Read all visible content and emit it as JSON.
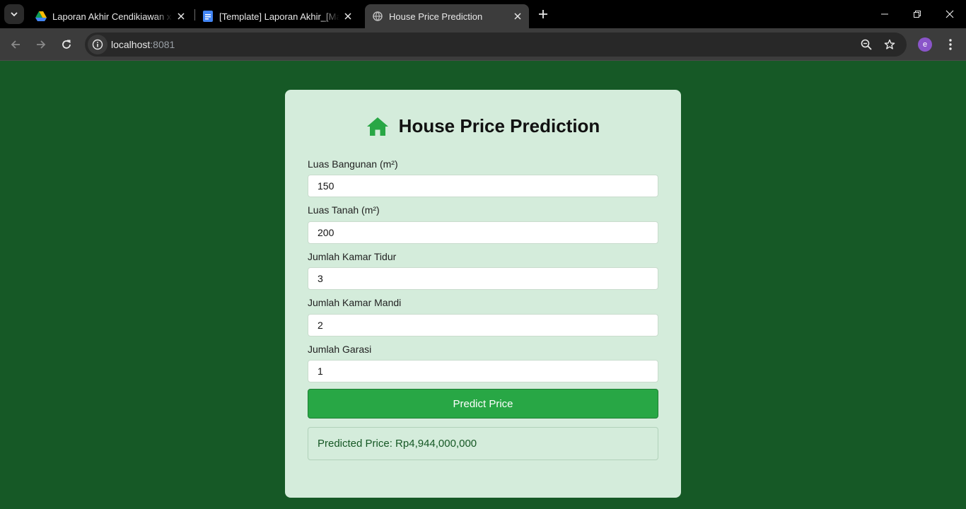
{
  "browser": {
    "tabs": [
      {
        "title": "Laporan Akhir Cendikiawan x Ka",
        "icon": "google-drive-icon",
        "active": false
      },
      {
        "title": "[Template] Laporan Akhir_[Mag",
        "icon": "google-docs-icon",
        "active": false
      },
      {
        "title": "House Price Prediction",
        "icon": "globe-icon",
        "active": true
      }
    ],
    "url_host": "localhost",
    "url_port": ":8081",
    "profile_initial": "e"
  },
  "page": {
    "title": "House Price Prediction",
    "fields": [
      {
        "label": "Luas Bangunan (m²)",
        "value": "150"
      },
      {
        "label": "Luas Tanah (m²)",
        "value": "200"
      },
      {
        "label": "Jumlah Kamar Tidur",
        "value": "3"
      },
      {
        "label": "Jumlah Kamar Mandi",
        "value": "2"
      },
      {
        "label": "Jumlah Garasi",
        "value": "1"
      }
    ],
    "button_label": "Predict Price",
    "result_text": "Predicted Price: Rp4,944,000,000"
  },
  "colors": {
    "page_background": "#165926",
    "card_background": "#d4ecdb",
    "accent_button": "#28a745",
    "result_text": "#155724",
    "home_icon": "#28a745"
  }
}
